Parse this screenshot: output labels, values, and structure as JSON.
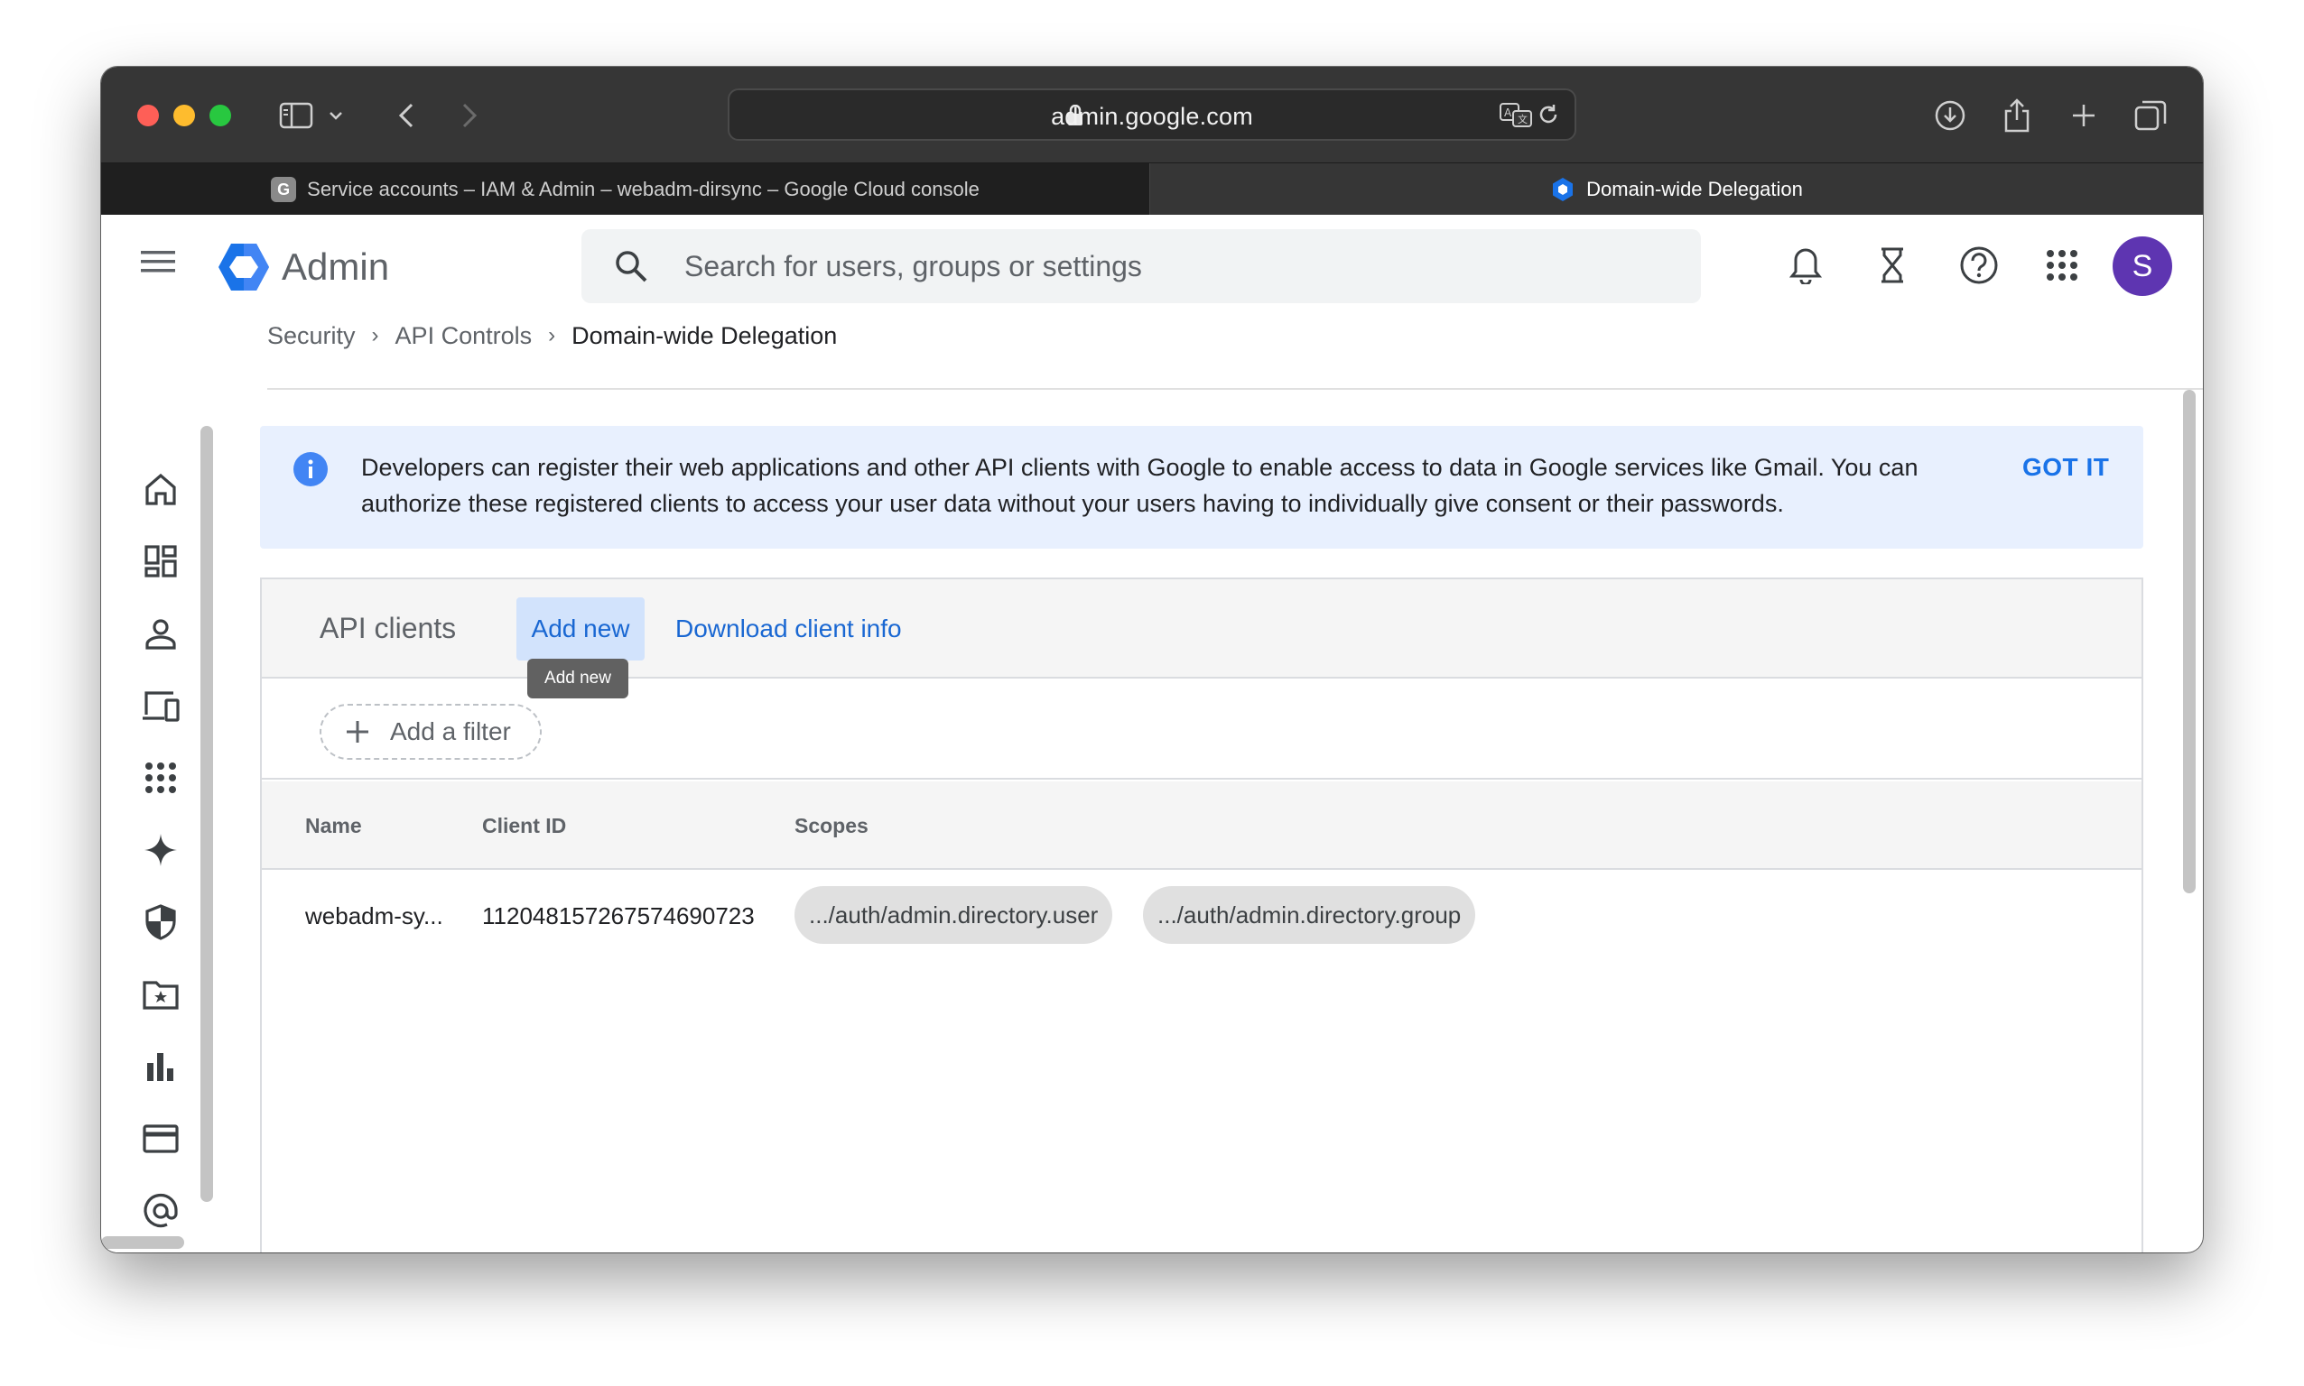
{
  "browser": {
    "url": "admin.google.com",
    "tabs": [
      {
        "label": "Service accounts – IAM & Admin – webadm-dirsync – Google Cloud console",
        "favicon": "G",
        "active": false
      },
      {
        "label": "Domain-wide Delegation",
        "active": true
      }
    ]
  },
  "header": {
    "app_title": "Admin",
    "search_placeholder": "Search for users, groups or settings",
    "avatar_letter": "S"
  },
  "breadcrumb": {
    "items": [
      "Security",
      "API Controls",
      "Domain-wide Delegation"
    ]
  },
  "banner": {
    "text": "Developers can register their web applications and other API clients with Google to enable access to data in Google services like Gmail. You can authorize these registered clients to access your user data without your users having to individually give consent or their passwords.",
    "action_label": "GOT IT"
  },
  "api_clients": {
    "title": "API clients",
    "add_new_label": "Add new",
    "tooltip": "Add new",
    "download_label": "Download client info",
    "filter_label": "Add a filter",
    "columns": [
      "Name",
      "Client ID",
      "Scopes"
    ],
    "rows": [
      {
        "name": "webadm-sy...",
        "client_id": "112048157267574690723",
        "scopes": [
          ".../auth/admin.directory.user",
          ".../auth/admin.directory.group"
        ]
      }
    ]
  },
  "colors": {
    "accent": "#1a73e8",
    "banner_bg": "#e8f0fe",
    "avatar_bg": "#5e35b1"
  }
}
